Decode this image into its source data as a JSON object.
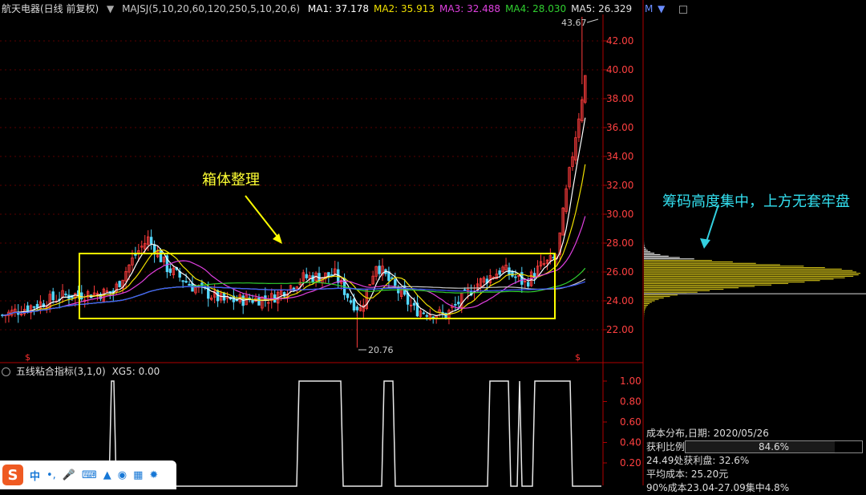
{
  "header": {
    "stock": "航天电器(日线 前复权)",
    "indicator": "MAJSJ(5,10,20,60,120,250,5,10,20,6)",
    "ma": [
      {
        "label": "MA1: 37.178",
        "color": "#ffffff"
      },
      {
        "label": "MA2: 35.913",
        "color": "#f0e000"
      },
      {
        "label": "MA3: 32.488",
        "color": "#e040e0"
      },
      {
        "label": "MA4: 28.030",
        "color": "#30d030"
      },
      {
        "label": "MA5: 26.329",
        "color": "#e0e0e0"
      }
    ],
    "more": "M",
    "colors": {
      "stock": "#cccccc",
      "indicator": "#cccccc"
    }
  },
  "main_chart": {
    "price_axis": [
      "42.00",
      "40.00",
      "38.00",
      "36.00",
      "34.00",
      "32.00",
      "30.00",
      "28.00",
      "26.00",
      "24.00",
      "22.00"
    ],
    "high_label": "43.67",
    "low_label": "20.76",
    "box_annotation": "箱体整理",
    "chips_annotation": "筹码高度集中，上方无套牢盘",
    "signal_glyph": "$"
  },
  "indicator_panel": {
    "title": "五线粘合指标(3,1,0)",
    "value": "XG5: 0.00",
    "axis": [
      "1.00",
      "0.80",
      "0.60",
      "0.40",
      "0.20"
    ]
  },
  "chart_data": {
    "type": "candlestick",
    "ylim": [
      20,
      44
    ],
    "y_ticks": [
      22,
      24,
      26,
      28,
      30,
      32,
      34,
      36,
      38,
      40,
      42
    ],
    "box_range": [
      22.9,
      27.6
    ],
    "period_high": 43.67,
    "period_low": 20.76,
    "xg5_signal_ylim": [
      0,
      1.1
    ],
    "xg5_signal_y_ticks": [
      0.2,
      0.4,
      0.6,
      0.8,
      1.0
    ]
  },
  "cost_distribution": {
    "title": "成本分布,日期: 2020/05/26",
    "profit_label": "获利比例:",
    "profit_value": "84.6%",
    "profit_ratio": 0.846,
    "line1": "24.49处获利盘: 32.6%",
    "line2": "平均成本: 25.20元",
    "line3": "90%成本23.04-27.09集中4.8%"
  },
  "taskbar": {
    "logo": "S",
    "items": [
      "中",
      "•,",
      "mic",
      "keyboard",
      "shirt",
      "gamepad",
      "apps",
      "settings"
    ]
  }
}
